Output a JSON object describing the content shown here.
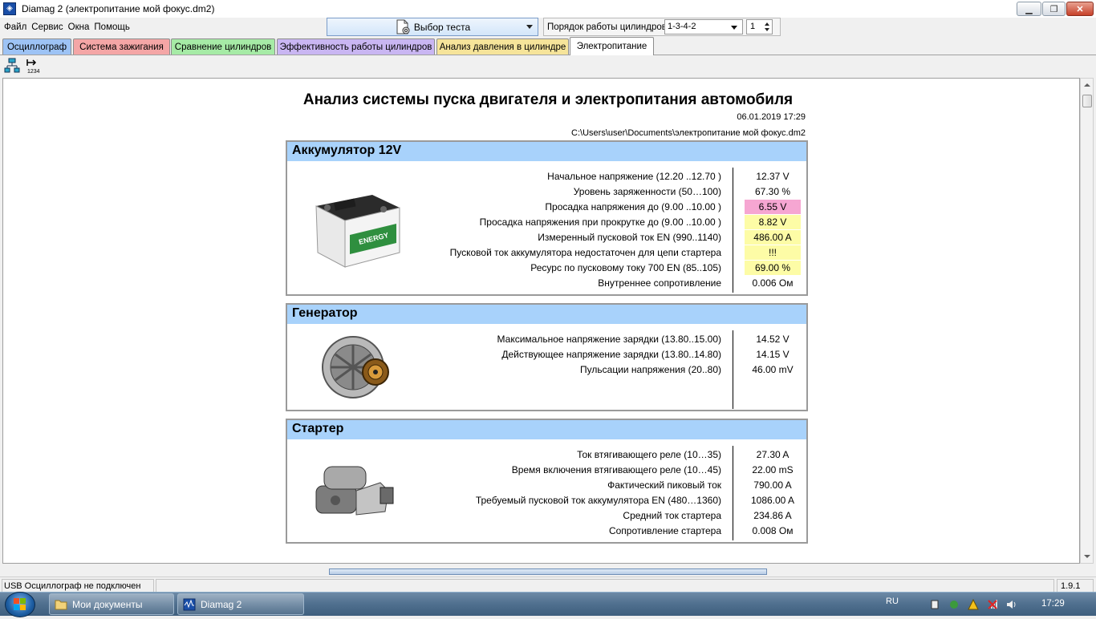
{
  "window": {
    "title": "Diamag 2 (электропитание мой фокус.dm2)",
    "controls": {
      "minimize": "▁",
      "maximize": "❐",
      "close": "✕"
    }
  },
  "menu": [
    "Файл",
    "Сервис",
    "Окна",
    "Помощь"
  ],
  "test_select": {
    "label": "Выбор теста"
  },
  "cylinder_order": {
    "label": "Порядок работы цилиндров",
    "value": "1-3-4-2",
    "cylinder": "1"
  },
  "tabs": [
    {
      "label": "Осциллограф",
      "color": "#9dc3f5"
    },
    {
      "label": "Система зажигания",
      "color": "#f4a6a6"
    },
    {
      "label": "Сравнение цилиндров",
      "color": "#a6eba6"
    },
    {
      "label": "Эффективность работы цилиндров",
      "color": "#c9b6f2"
    },
    {
      "label": "Анализ давления в цилиндре",
      "color": "#f6e49a"
    },
    {
      "label": "Электропитание",
      "color": "#ffffff",
      "active": true
    }
  ],
  "toolbar": {
    "icons": [
      "network-icon",
      "numbering-1234-icon"
    ]
  },
  "report": {
    "title": "Анализ системы пуска двигателя и электропитания автомобиля",
    "date": "06.01.2019 17:29",
    "path": "C:\\Users\\user\\Documents\\электропитание мой фокус.dm2",
    "sections": [
      {
        "name": "Аккумулятор 12V",
        "image": "battery-image",
        "rows": [
          {
            "label": "Начальное напряжение (12.20 ..12.70 )",
            "value": "12.37 V",
            "highlight": "none"
          },
          {
            "label": "Уровень заряженности (50…100)",
            "value": "67.30 %",
            "highlight": "none"
          },
          {
            "label": "Просадка напряжения до (9.00 ..10.00 )",
            "value": "6.55 V",
            "highlight": "pink"
          },
          {
            "label": "Просадка напряжения при прокрутке до (9.00 ..10.00 )",
            "value": "8.82 V",
            "highlight": "yellow"
          },
          {
            "label": "Измеренный пусковой ток  EN (990..1140)",
            "value": "486.00 A",
            "highlight": "yellow"
          },
          {
            "label": "Пусковой ток аккумулятора недостаточен для цепи стартера",
            "value": "!!!",
            "highlight": "yellow"
          },
          {
            "label": "Ресурс по пусковому току  700 EN (85..105)",
            "value": "69.00 %",
            "highlight": "yellow"
          },
          {
            "label": "Внутреннее сопротивление",
            "value": "0.006 Ом",
            "highlight": "none"
          }
        ]
      },
      {
        "name": "Генератор",
        "image": "alternator-image",
        "rows": [
          {
            "label": "Максимальное напряжение зарядки  (13.80..15.00)",
            "value": "14.52 V",
            "highlight": "none"
          },
          {
            "label": "Действующее напряжение зарядки (13.80..14.80)",
            "value": "14.15 V",
            "highlight": "none"
          },
          {
            "label": "Пульсации напряжения (20..80)",
            "value": "46.00 mV",
            "highlight": "none"
          }
        ]
      },
      {
        "name": "Стартер",
        "image": "starter-image",
        "rows": [
          {
            "label": "Ток втягивающего реле (10…35)",
            "value": "27.30 A",
            "highlight": "none"
          },
          {
            "label": "Время включения втягивающего реле (10…45)",
            "value": "22.00 mS",
            "highlight": "none"
          },
          {
            "label": "Фактический пиковый ток",
            "value": "790.00 A",
            "highlight": "none"
          },
          {
            "label": "Требуемый пусковой ток аккумулятора  EN (480…1360)",
            "value": "1086.00 A",
            "highlight": "none"
          },
          {
            "label": "Средний ток стартера",
            "value": "234.86 A",
            "highlight": "none"
          },
          {
            "label": "Сопротивление стартера",
            "value": "0.008 Ом",
            "highlight": "none"
          }
        ]
      }
    ]
  },
  "status": {
    "left": "USB Осциллограф не подключен",
    "version": "1.9.1"
  },
  "taskbar": {
    "items": [
      {
        "label": "Мои документы",
        "icon": "folder-icon"
      },
      {
        "label": "Diamag 2",
        "icon": "diamag-icon"
      }
    ],
    "language": "RU",
    "time": "17:29"
  }
}
